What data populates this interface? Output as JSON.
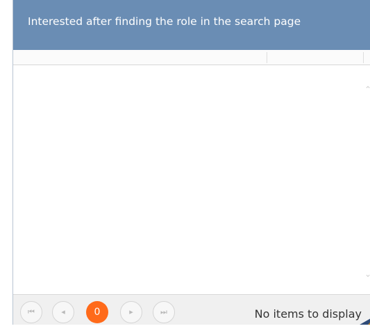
{
  "header": {
    "title": "Interested after finding the role in the search page"
  },
  "pager": {
    "current_page": "0",
    "info_text": "No items to display",
    "first_icon": "first-page-icon",
    "prev_icon": "previous-page-icon",
    "next_icon": "next-page-icon",
    "last_icon": "last-page-icon"
  },
  "colors": {
    "header_bg": "#6a8db4",
    "current_page_bg": "#ff6a1a",
    "panel_border": "#b8c4d2"
  }
}
